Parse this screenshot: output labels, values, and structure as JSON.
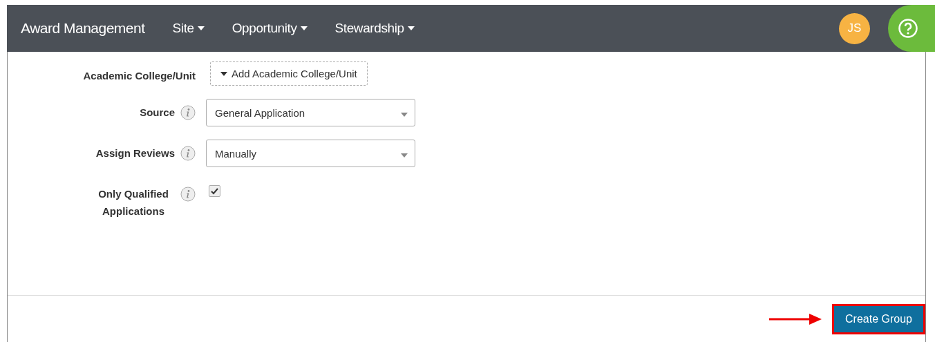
{
  "nav": {
    "brand": "Award Management",
    "menus": [
      {
        "label": "Site"
      },
      {
        "label": "Opportunity"
      },
      {
        "label": "Stewardship"
      }
    ],
    "avatar": "JS"
  },
  "form": {
    "rows": [
      {
        "kind": "add",
        "label": "Academic College/Unit",
        "info": false,
        "value": "Add Academic College/Unit"
      },
      {
        "kind": "select",
        "label": "Source",
        "info": true,
        "value": "General Application"
      },
      {
        "kind": "select",
        "label": "Assign Reviews",
        "info": true,
        "value": "Manually"
      },
      {
        "kind": "checkbox",
        "label": "Only Qualified Applications",
        "info": true,
        "checked": true
      }
    ]
  },
  "footer": {
    "button": "Create Group",
    "highlighted": true
  }
}
